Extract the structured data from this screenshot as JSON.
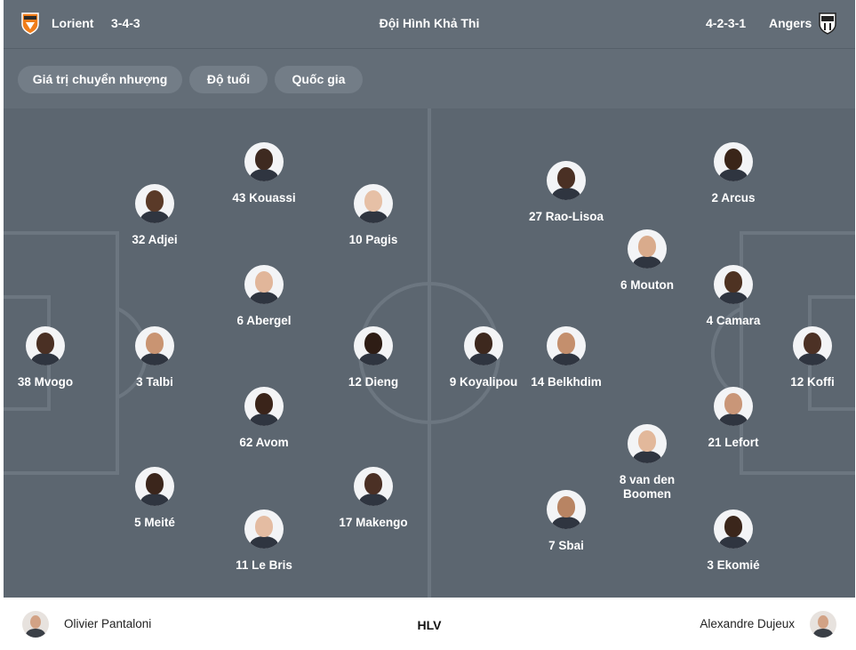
{
  "header": {
    "title": "Đội Hình Khả Thi",
    "home": {
      "name": "Lorient",
      "formation": "3-4-3",
      "crest_icon": "lorient-crest-icon",
      "crest_color": "#f07d1a"
    },
    "away": {
      "name": "Angers",
      "formation": "4-2-3-1",
      "crest_icon": "angers-crest-icon",
      "crest_color": "#222222"
    }
  },
  "filters": [
    "Giá trị chuyển nhượng",
    "Độ tuổi",
    "Quốc gia"
  ],
  "home_players": [
    {
      "label": "38 Mvogo",
      "skin": "#4a3024"
    },
    {
      "label": "3 Talbi",
      "skin": "#c99472"
    },
    {
      "label": "32 Adjei",
      "skin": "#5a3a28"
    },
    {
      "label": "5 Meité",
      "skin": "#3b261c"
    },
    {
      "label": "43 Kouassi",
      "skin": "#3e2a20"
    },
    {
      "label": "6 Abergel",
      "skin": "#e1b69a"
    },
    {
      "label": "62 Avom",
      "skin": "#3a241a"
    },
    {
      "label": "11 Le Bris",
      "skin": "#e4bca2"
    },
    {
      "label": "10 Pagis",
      "skin": "#e6c0a6"
    },
    {
      "label": "12 Dieng",
      "skin": "#2e1d15"
    },
    {
      "label": "17 Makengo",
      "skin": "#4b3025"
    }
  ],
  "away_players": [
    {
      "label": "9 Koyalipou",
      "skin": "#3d281e"
    },
    {
      "label": "14 Belkhdim",
      "skin": "#c48f6d"
    },
    {
      "label": "27 Rao-Lisoa",
      "skin": "#4a3024"
    },
    {
      "label": "7 Sbai",
      "skin": "#b88463"
    },
    {
      "label": "6 Mouton",
      "skin": "#d9ab8c"
    },
    {
      "label": "8 van den Boomen",
      "skin": "#e2b89b"
    },
    {
      "label": "2 Arcus",
      "skin": "#3a2519"
    },
    {
      "label": "4 Camara",
      "skin": "#4e3222"
    },
    {
      "label": "21 Lefort",
      "skin": "#c99678"
    },
    {
      "label": "3 Ekomié",
      "skin": "#3b261b"
    },
    {
      "label": "12 Koffi",
      "skin": "#4c3125"
    }
  ],
  "coaches": {
    "home": "Olivier Pantaloni",
    "label": "HLV",
    "away": "Alexandre Dujeux"
  },
  "colors": {
    "pitch": "#5c6670",
    "header": "#636d77",
    "chip": "#737d87",
    "lines": "#6c7680"
  }
}
